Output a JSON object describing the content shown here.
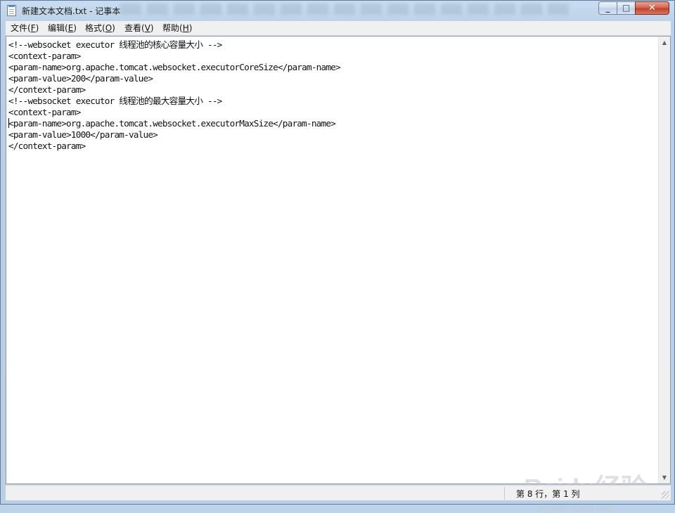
{
  "window": {
    "title": "新建文本文档.txt - 记事本",
    "buttons": {
      "minimize": "▭",
      "maximize": "☐",
      "close": "✕"
    }
  },
  "menu": [
    {
      "label": "文件(",
      "key": "F",
      "tail": ")"
    },
    {
      "label": "编辑(",
      "key": "E",
      "tail": ")"
    },
    {
      "label": "格式(",
      "key": "O",
      "tail": ")"
    },
    {
      "label": "查看(",
      "key": "V",
      "tail": ")"
    },
    {
      "label": "帮助(",
      "key": "H",
      "tail": ")"
    }
  ],
  "editor": {
    "lines": [
      "<!--websocket executor 线程池的核心容量大小 -->",
      "<context-param>",
      "<param-name>org.apache.tomcat.websocket.executorCoreSize</param-name>",
      "<param-value>200</param-value>",
      "</context-param>",
      "<!--websocket executor 线程池的最大容量大小 -->",
      "<context-param>",
      "<param-name>org.apache.tomcat.websocket.executorMaxSize</param-name>",
      "<param-value>1000</param-value>",
      "</context-param>"
    ],
    "caret_line": 8,
    "caret_column": 1
  },
  "status": {
    "position": "第 8 行，第 1 列"
  },
  "watermark": {
    "logo": "Baidu经验",
    "domain": "jingyan.baidu.com"
  },
  "icons": {
    "app": "notepad-icon",
    "scroll_up": "arrow-up-icon",
    "scroll_down": "arrow-down-icon",
    "resize": "resize-grip-icon"
  }
}
